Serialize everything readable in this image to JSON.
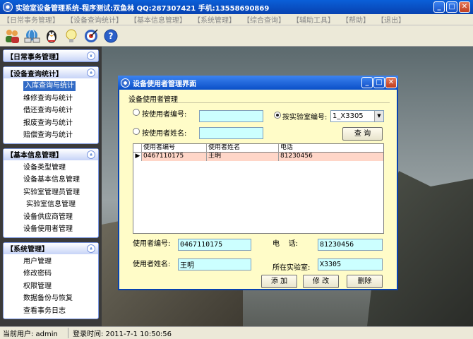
{
  "window": {
    "title": "实验室设备管理系统-程序测试:双鱼林 QQ:287307421 手机:13558690869",
    "controls": {
      "minimize": "_",
      "maximize": "□",
      "close": "✕"
    }
  },
  "menu": [
    "【日常事务管理】",
    "【设备查询统计】",
    "【基本信息管理】",
    "【系统管理】",
    "【综合查询】",
    "【辅助工具】",
    "【帮助】",
    "【退出】"
  ],
  "toolbar": {
    "icons": [
      "users-icon",
      "network-icon",
      "qq-penguin-icon",
      "lightbulb-icon",
      "target-icon",
      "help-icon"
    ],
    "help_glyph": "?"
  },
  "sidebar": {
    "chevron": "«",
    "panels": [
      {
        "title": "【日常事务管理】",
        "items": []
      },
      {
        "title": "【设备查询统计】",
        "items": [
          "入库查询与统计",
          "维修查询与统计",
          "借还查询与统计",
          "报废查询与统计",
          "赔偿查询与统计"
        ],
        "selected": 0
      },
      {
        "title": "【基本信息管理】",
        "items": [
          "设备类型管理",
          "设备基本信息管理",
          "实验室管理员管理",
          "实验室信息管理",
          "设备供应商管理",
          "设备使用者管理"
        ]
      },
      {
        "title": "【系统管理】",
        "items": [
          "用户管理",
          "修改密码",
          "权限管理",
          "数据备份与恢复",
          "查看事务日志"
        ]
      }
    ]
  },
  "status": {
    "user": "当前用户: admin",
    "login_time": "登录时间: 2011-7-1 10:50:56"
  },
  "dialog": {
    "title": "设备使用者管理界面",
    "group_label": "设备使用者管理",
    "search": {
      "by_id_label": "按使用者编号:",
      "by_name_label": "按使用者姓名:",
      "by_lab_label": "按实验室编号:",
      "lab_value": "1_X3305",
      "query_button": "查 询",
      "selected_mode": "lab"
    },
    "grid": {
      "indicator": "▶",
      "columns": [
        "使用者编号",
        "使用者姓名",
        "电话"
      ],
      "rows": [
        [
          "0467110175",
          "王明",
          "81230456"
        ]
      ]
    },
    "form": {
      "id_label": "使用者编号:",
      "id_value": "0467110175",
      "phone_label": "电    话:",
      "phone_value": "81230456",
      "name_label": "使用者姓名:",
      "name_value": "王明",
      "lab_label": "所在实验室:",
      "lab_value": "X3305"
    },
    "buttons": {
      "add": "添 加",
      "modify": "修 改",
      "delete": "删除"
    }
  }
}
